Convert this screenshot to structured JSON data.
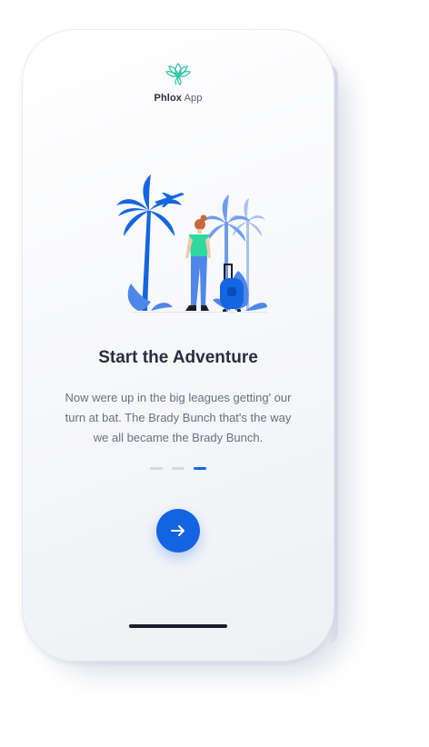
{
  "app": {
    "brand_bold": "Phlox",
    "brand_light": "App",
    "logo_icon": "lotus-logo-icon",
    "logo_color": "#2ec4a6"
  },
  "onboarding": {
    "illustration_icon": "traveler-palm-trees-illustration",
    "title": "Start the Adventure",
    "description": "Now were up in the big leagues getting' our turn at bat. The Brady Bunch that's the way we all became the Brady Bunch.",
    "page_indicator": {
      "total": 3,
      "current": 3
    },
    "next_button_icon": "arrow-right-icon"
  },
  "colors": {
    "accent": "#1463e2",
    "title": "#2b2d3f",
    "body_text": "#6b7080",
    "dot_inactive": "#d4d8e0"
  }
}
